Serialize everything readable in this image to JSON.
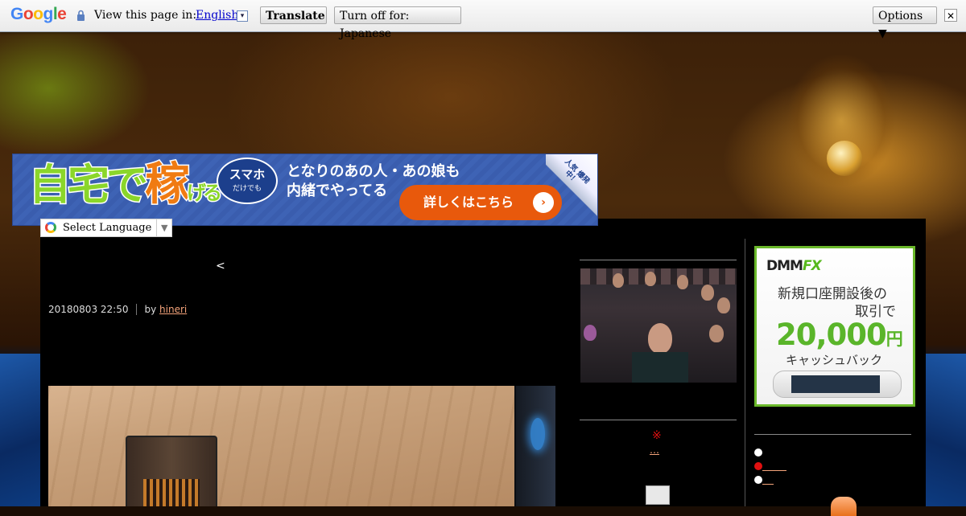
{
  "translate_bar": {
    "logo": "Google",
    "prompt": "View this page in:",
    "language": "English",
    "language_dropdown": "▾",
    "translate_button": "Translate",
    "turn_off_button": "Turn off for: Japanese",
    "options_button": "Options ▼",
    "close": "✕"
  },
  "banner_ad": {
    "headline_1": "自宅で",
    "headline_big": "稼",
    "headline_2": "げる",
    "bubble_line1": "スマホ",
    "bubble_line2": "だけでも",
    "copy_line1": "となりのあの人・あの娘も",
    "copy_line2": "内緒でやってる",
    "cta": "詳しくはこちら",
    "cta_arrow": "›",
    "corner_badge": "人気 爆発中！"
  },
  "language_select": {
    "label": "Select Language",
    "caret": "▼"
  },
  "post": {
    "nav": "<",
    "date": "20180803 22:50",
    "by": "by",
    "author": "hineri"
  },
  "middle_column": {
    "mark": "※",
    "link": "…"
  },
  "right_ad": {
    "brand_a": "DMM",
    "brand_b": "FX",
    "line1": "新規口座開設後の",
    "line2": "取引で",
    "amount": "20,000",
    "currency": "円",
    "line3": "キャッシュバック"
  },
  "right_list": [
    {
      "dot": "white",
      "text": ""
    },
    {
      "dot": "red",
      "text": ""
    },
    {
      "dot": "white",
      "text": ""
    }
  ],
  "colors": {
    "link": "#f4a37a",
    "accent_green": "#5ab52a",
    "cta_orange": "#e8590c",
    "banner_blue": "#3e63b5",
    "google_link": "#0000cc"
  },
  "icons": [
    "lock-icon",
    "google-g-icon",
    "close-icon",
    "dropdown-caret-icon",
    "rss-icon",
    "arrow-circle-icon"
  ]
}
